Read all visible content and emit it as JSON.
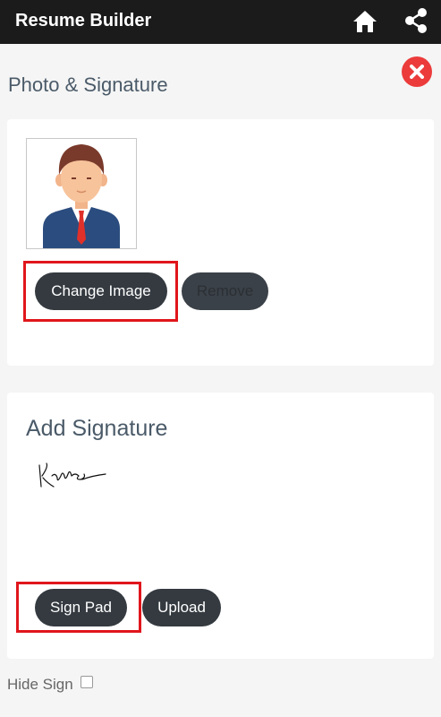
{
  "app_bar": {
    "title": "Resume Builder",
    "home_icon": "home-icon",
    "share_icon": "share-icon"
  },
  "page": {
    "title": "Photo & Signature",
    "close_icon": "close-icon",
    "close_color": "#ec3b3b"
  },
  "photo_section": {
    "avatar_icon": "person-avatar-icon",
    "change_image_label": "Change Image",
    "remove_label": "Remove"
  },
  "signature_section": {
    "heading": "Add Signature",
    "signature_image": "handwritten-signature",
    "sign_pad_label": "Sign Pad",
    "upload_label": "Upload"
  },
  "hide_sign": {
    "label": "Hide Sign",
    "checked": false
  },
  "colors": {
    "app_bar": "#1b1b1b",
    "button": "#343a40",
    "highlight": "#e0161c",
    "heading": "#4a5a68"
  }
}
